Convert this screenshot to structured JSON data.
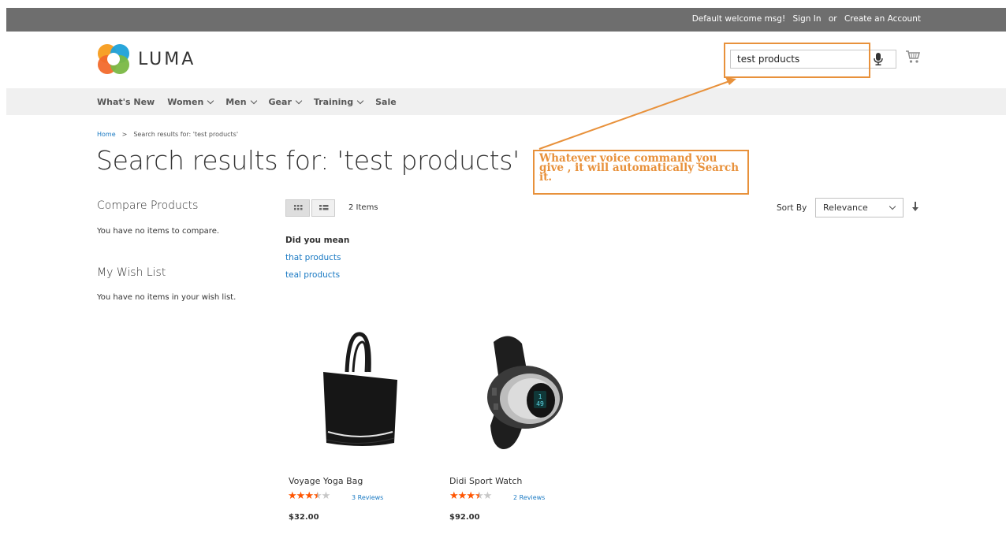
{
  "header": {
    "welcome": "Default welcome msg!",
    "sign_in": "Sign In",
    "or": "or",
    "create_account": "Create an Account",
    "logo_text": "LUMA"
  },
  "search": {
    "value": "test products"
  },
  "nav": {
    "items": [
      {
        "label": "What's New",
        "dropdown": false
      },
      {
        "label": "Women",
        "dropdown": true
      },
      {
        "label": "Men",
        "dropdown": true
      },
      {
        "label": "Gear",
        "dropdown": true
      },
      {
        "label": "Training",
        "dropdown": true
      },
      {
        "label": "Sale",
        "dropdown": false
      }
    ]
  },
  "breadcrumb": {
    "home": "Home",
    "separator": ">",
    "current": "Search results for: 'test products'"
  },
  "page_title": "Search results for: 'test products'",
  "annotation": {
    "text": "Whatever voice command you give , it will automatically Search it.",
    "color": "#e8913b"
  },
  "sidebar": {
    "compare_title": "Compare Products",
    "compare_empty": "You have no items to compare.",
    "wishlist_title": "My Wish List",
    "wishlist_empty": "You have no items in your wish list."
  },
  "toolbar": {
    "items_count": "2 Items",
    "sort_label": "Sort By",
    "sort_value": "Relevance"
  },
  "suggestions": {
    "title": "Did you mean",
    "items": [
      "that products",
      "teal products"
    ]
  },
  "products": [
    {
      "name": "Voyage Yoga Bag",
      "rating": 3.5,
      "rating_max": 5,
      "reviews": "3 Reviews",
      "price": "$32.00"
    },
    {
      "name": "Didi Sport Watch",
      "rating": 3.5,
      "rating_max": 5,
      "reviews": "2 Reviews",
      "price": "$92.00"
    }
  ],
  "colors": {
    "link": "#1979c3",
    "star": "#ff5501",
    "topbar": "#6e6e6e",
    "navbar": "#f0f0f0"
  }
}
